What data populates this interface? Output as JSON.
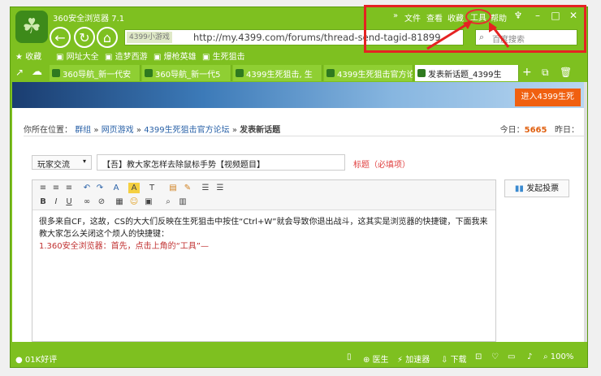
{
  "window": {
    "title": "360安全浏览器 7.1",
    "menu": [
      "文件",
      "查看",
      "收藏",
      "工具",
      "帮助"
    ],
    "chevrons": "»",
    "controls": {
      "skin": "♆",
      "minimize": "–",
      "maximize": "□",
      "close": "✕"
    }
  },
  "nav": {
    "back_glyph": "←",
    "refresh_glyph": "↻",
    "home_glyph": "⌂"
  },
  "address": {
    "badge": "4399小游戏",
    "url": "http://my.4399.com/forums/thread-send-tagid-81899"
  },
  "search": {
    "placeholder": "百度搜索"
  },
  "bookmarks": [
    "收藏",
    "网址大全",
    "造梦西游",
    "爆枪英雄",
    "生死狙击"
  ],
  "tabs": [
    {
      "label": "360导航_新一代安"
    },
    {
      "label": "360导航_新一代5"
    },
    {
      "label": "4399生死狙击, 生"
    },
    {
      "label": "4399生死狙击官方论"
    },
    {
      "label": "发表新话题_4399生"
    }
  ],
  "page": {
    "banner_button": "进入4399生死",
    "breadcrumb": {
      "prefix": "你所在位置：",
      "items": [
        "群组",
        "网页游戏",
        "4399生死狙击官方论坛"
      ],
      "sep": "»",
      "current": "发表新话题"
    },
    "stats": {
      "today_label": "今日：",
      "today": "5665",
      "yesterday_label": "昨日："
    },
    "category": "玩家交流",
    "subject": "【吾】教大家怎样去除鼠标手势【视频题目】",
    "required": "标题（必填项）",
    "poll_button": "发起投票",
    "editor_lines": [
      "很多来自CF，这故，CS的大大们反映在生死狙击中按住“Ctrl+W”就会导致你退出战斗，这其实是浏览器的快捷键，下面我来教大家怎么关闭这个烦人的快捷键：",
      "1.360安全浏览器：首先，点击上角的“工具”—"
    ]
  },
  "status": {
    "left": "01K好评",
    "doctor": "医生",
    "accel": "加速器",
    "download": "下载",
    "zoom": "100%"
  },
  "colors": {
    "chrome_green": "#7ec020",
    "highlight_red": "#e52222",
    "today_orange": "#e06010"
  }
}
